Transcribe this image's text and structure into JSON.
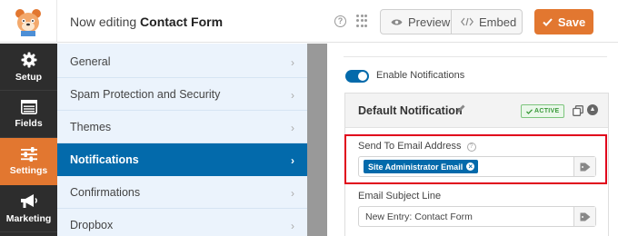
{
  "header": {
    "editing_prefix": "Now editing",
    "form_name": "Contact Form",
    "help_glyph": "?",
    "preview_label": "Preview",
    "embed_label": "Embed",
    "save_label": "Save",
    "accent_color": "#e27730"
  },
  "leftnav": {
    "items": [
      {
        "label": "Setup",
        "icon": "gear-icon"
      },
      {
        "label": "Fields",
        "icon": "fields-icon"
      },
      {
        "label": "Settings",
        "icon": "sliders-icon",
        "active": true
      },
      {
        "label": "Marketing",
        "icon": "megaphone-icon"
      }
    ]
  },
  "settings_menu": {
    "items": [
      {
        "label": "General"
      },
      {
        "label": "Spam Protection and Security"
      },
      {
        "label": "Themes"
      },
      {
        "label": "Notifications",
        "active": true
      },
      {
        "label": "Confirmations"
      },
      {
        "label": "Dropbox"
      }
    ],
    "chevron": "›",
    "active_color": "#036aab"
  },
  "notifications": {
    "toggle_label": "Enable Notifications",
    "toggle_on": true,
    "card_title": "Default Notification",
    "status_badge": "ACTIVE",
    "send_to": {
      "label": "Send To Email Address",
      "help_glyph": "?",
      "chip": "Site Administrator Email",
      "chip_remove": "×"
    },
    "subject": {
      "label": "Email Subject Line",
      "value": "New Entry: Contact Form"
    }
  }
}
